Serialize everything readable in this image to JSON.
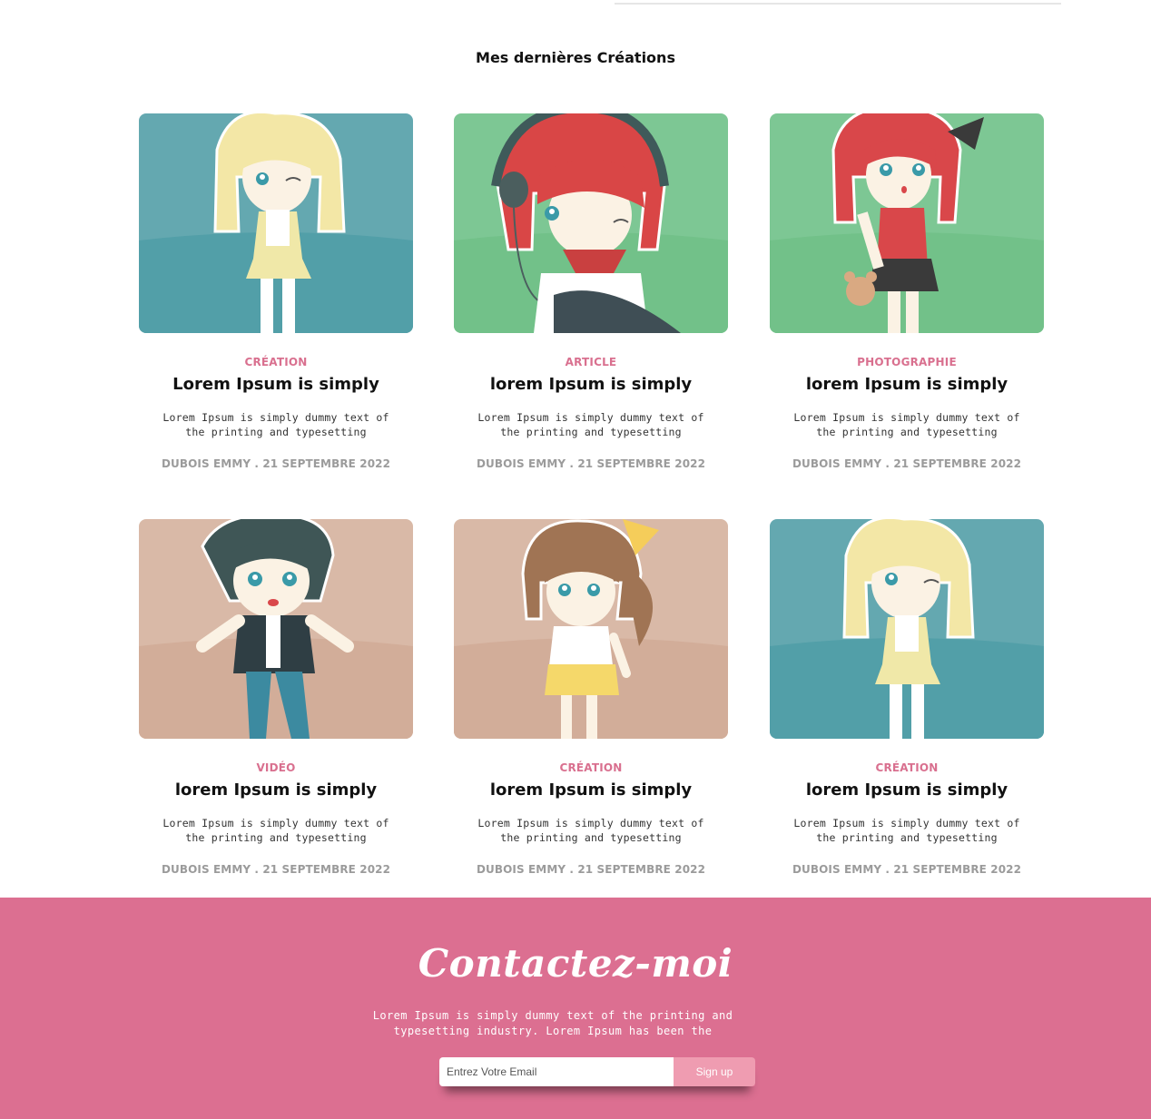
{
  "section": {
    "title": "Mes dernières Créations"
  },
  "cards": [
    {
      "category": "CRÉATION",
      "title": "Lorem Ipsum is simply",
      "description": "Lorem Ipsum is simply dummy text of the printing and typesetting",
      "meta": "DUBOIS EMMY . 21 SEPTEMBRE 2022",
      "image": "anime-girl-blonde",
      "color": "#5fa5ae"
    },
    {
      "category": "ARTICLE",
      "title": "lorem Ipsum is simply",
      "description": "Lorem Ipsum is simply dummy text of the printing and typesetting",
      "meta": "DUBOIS EMMY . 21 SEPTEMBRE 2022",
      "image": "anime-girl-headphones",
      "color": "#7dc794"
    },
    {
      "category": "PHOTOGRAPHIE",
      "title": "lorem Ipsum is simply",
      "description": "Lorem Ipsum is simply dummy text of the printing and typesetting",
      "meta": "DUBOIS EMMY . 21 SEPTEMBRE 2022",
      "image": "anime-girl-teddy-bear",
      "color": "#7dc794"
    },
    {
      "category": "VIDÉO",
      "title": "lorem Ipsum is simply",
      "description": "Lorem Ipsum is simply dummy text of the printing and typesetting",
      "meta": "DUBOIS EMMY . 21 SEPTEMBRE 2022",
      "image": "anime-boy",
      "color": "#d8b8a6"
    },
    {
      "category": "CRÉATION",
      "title": "lorem Ipsum is simply",
      "description": "Lorem Ipsum is simply dummy text of the printing and typesetting",
      "meta": "DUBOIS EMMY . 21 SEPTEMBRE 2022",
      "image": "anime-girl-ponytail",
      "color": "#d8b8a6"
    },
    {
      "category": "CRÉATION",
      "title": "lorem Ipsum is simply",
      "description": "Lorem Ipsum is simply dummy text of the printing and typesetting",
      "meta": "DUBOIS EMMY . 21 SEPTEMBRE 2022",
      "image": "anime-girl-blonde",
      "color": "#5fa5ae"
    }
  ],
  "contact": {
    "title": "Contactez-moi",
    "text": "Lorem Ipsum is simply dummy text of the printing and typesetting industry. Lorem Ipsum has been the",
    "email_placeholder": "Entrez Votre Email",
    "email_value": "",
    "button_label": "Sign up",
    "background_color": "#dc6f91",
    "button_color": "#ef9cb1"
  },
  "colors": {
    "category": "#d9708f",
    "meta": "#9b9b9b"
  }
}
